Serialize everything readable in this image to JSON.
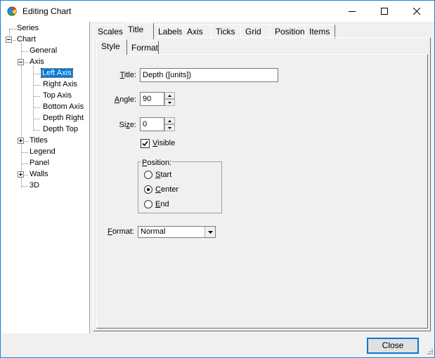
{
  "window": {
    "title": "Editing Chart"
  },
  "tree": {
    "items": [
      {
        "label": "Series"
      },
      {
        "label": "Chart"
      },
      {
        "label": "General"
      },
      {
        "label": "Axis"
      },
      {
        "label": "Left Axis"
      },
      {
        "label": "Right Axis"
      },
      {
        "label": "Top Axis"
      },
      {
        "label": "Bottom Axis"
      },
      {
        "label": "Depth Right"
      },
      {
        "label": "Depth Top"
      },
      {
        "label": "Titles"
      },
      {
        "label": "Legend"
      },
      {
        "label": "Panel"
      },
      {
        "label": "Walls"
      },
      {
        "label": "3D"
      }
    ],
    "selected": "Left Axis"
  },
  "tabs": [
    {
      "label": "Scales"
    },
    {
      "label": "Title"
    },
    {
      "label": "Labels"
    },
    {
      "label": "Axis"
    },
    {
      "label": "Ticks"
    },
    {
      "label": "Grid"
    },
    {
      "label": "Position"
    },
    {
      "label": "Items"
    }
  ],
  "active_tab": "Title",
  "subtabs": [
    {
      "label": "Style"
    },
    {
      "label": "Format"
    }
  ],
  "active_subtab": "Style",
  "form": {
    "title_label_u": "T",
    "title_label_rest": "itle:",
    "title_value": "Depth ([units])",
    "angle_label_u": "A",
    "angle_label_rest": "ngle:",
    "angle_value": "90",
    "size_label_pre": "Si",
    "size_label_u": "z",
    "size_label_rest": "e:",
    "size_value": "0",
    "visible_label_u": "V",
    "visible_label_rest": "isible",
    "visible_checked": true,
    "position_label_u": "P",
    "position_label_rest": "osition:",
    "position_options": [
      {
        "u": "S",
        "rest": "tart"
      },
      {
        "u": "C",
        "rest": "enter"
      },
      {
        "u": "E",
        "rest": "nd"
      }
    ],
    "position_selected": "Center",
    "format_label_u": "F",
    "format_label_rest": "ormat:",
    "format_value": "Normal"
  },
  "footer": {
    "close_label": "Close"
  },
  "colors": {
    "accent": "#0078d7",
    "window_border": "#1883d7",
    "face": "#f0f0f0"
  }
}
